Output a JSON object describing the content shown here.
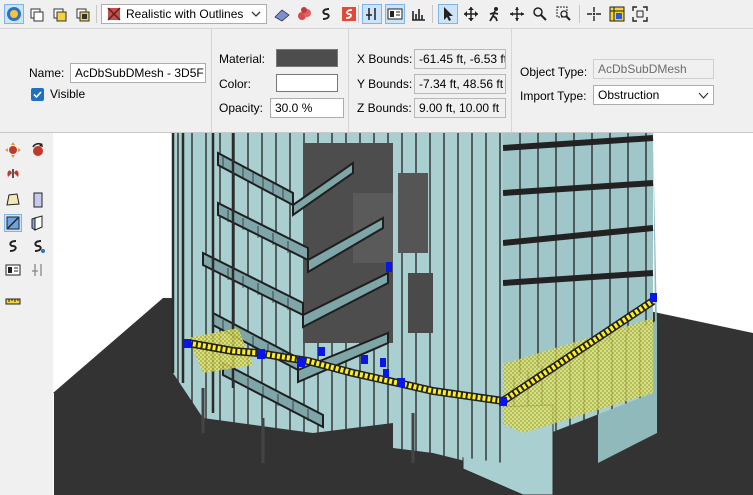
{
  "toolbar": {
    "view_mode": "Realistic with Outlines",
    "tools_left": [
      "zoom-extents-icon",
      "new-floor-icon",
      "cube-icon",
      "solid-icon"
    ],
    "tools_right": [
      "plane-icon",
      "hazard-icon",
      "path-icon",
      "dimension-icon",
      "hide-icon",
      "select-icon",
      "record-icon",
      "chart-icon",
      "arrow-icon",
      "pan-icon",
      "walk-icon",
      "move-icon",
      "zoom-icon",
      "zoom-window-icon",
      "point-icon",
      "grid-icon",
      "fit-icon"
    ]
  },
  "properties": {
    "name_label": "Name:",
    "name_value": "AcDbSubDMesh - 3D5F",
    "visible_label": "Visible",
    "material_label": "Material:",
    "material_color": "#4d4d4d",
    "color_label": "Color:",
    "color_value": "#ffffff",
    "opacity_label": "Opacity:",
    "opacity_value": "30.0 %",
    "x_bounds_label": "X Bounds:",
    "x_bounds_value": "-61.45 ft, -6.53 ft",
    "y_bounds_label": "Y Bounds:",
    "y_bounds_value": "-7.34 ft, 48.56 ft",
    "z_bounds_label": "Z Bounds:",
    "z_bounds_value": "9.00 ft, 10.00 ft",
    "object_type_label": "Object Type:",
    "object_type_value": "AcDbSubDMesh",
    "import_type_label": "Import Type:",
    "import_type_value": "Obstruction"
  },
  "colors": {
    "glass": "#a9cfd0",
    "frame": "#3a3a3a",
    "floor": "#2f2f2f",
    "selection": "#ffef1f",
    "handles": "#0a16e6"
  }
}
